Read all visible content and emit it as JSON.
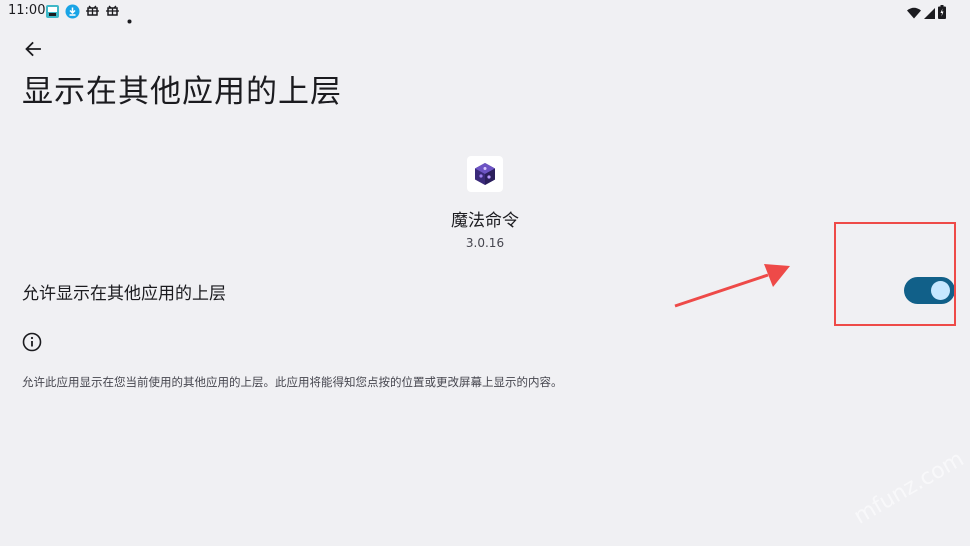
{
  "status_bar": {
    "time": "11:00",
    "notification_icons": [
      "app-notification-icon",
      "download-icon",
      "bug-icon",
      "bug-icon",
      "dot-icon"
    ],
    "system_icons": [
      "wifi-icon",
      "signal-icon",
      "battery-charging-icon"
    ]
  },
  "header": {
    "back_icon": "arrow-left-icon",
    "title": "显示在其他应用的上层"
  },
  "app": {
    "icon": "purple-cube-icon",
    "name": "魔法命令",
    "version": "3.0.16"
  },
  "setting": {
    "label": "允许显示在其他应用的上层",
    "enabled": true
  },
  "info": {
    "icon": "info-icon",
    "text": "允许此应用显示在您当前使用的其他应用的上层。此应用将能得知您点按的位置或更改屏幕上显示的内容。"
  },
  "annotation": {
    "box_color": "#ee4a48",
    "arrow_color": "#ee4a48"
  },
  "watermark": "mfunz.com",
  "colors": {
    "background": "#f0f0f3",
    "toggle_track": "#116089",
    "toggle_knob": "#c6e7ff"
  }
}
